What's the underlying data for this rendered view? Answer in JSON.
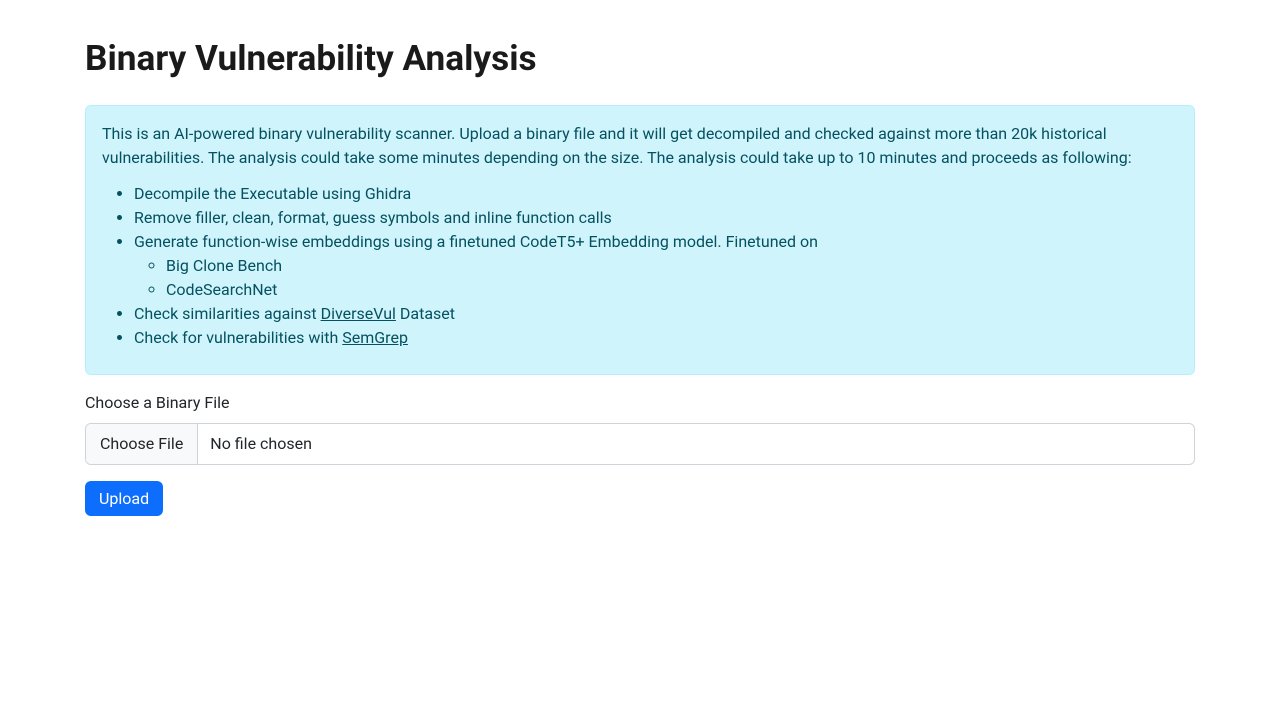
{
  "header": {
    "title": "Binary Vulnerability Analysis"
  },
  "info": {
    "intro": "This is an AI-powered binary vulnerability scanner. Upload a binary file and it will get decompiled and checked against more than 20k historical vulnerabilities. The analysis could take some minutes depending on the size. The analysis could take up to 10 minutes and proceeds as following:",
    "steps": {
      "s1": "Decompile the Executable using Ghidra",
      "s2": "Remove filler, clean, format, guess symbols and inline function calls",
      "s3": "Generate function-wise embeddings using a finetuned CodeT5+ Embedding model. Finetuned on",
      "s3a": "Big Clone Bench",
      "s3b": "CodeSearchNet",
      "s4_pre": "Check similarities against ",
      "s4_link": "DiverseVul",
      "s4_post": " Dataset",
      "s5_pre": "Check for vulnerabilities with ",
      "s5_link": "SemGrep"
    }
  },
  "form": {
    "file_label": "Choose a Binary File",
    "choose_file_button": "Choose File",
    "no_file_text": "No file chosen",
    "upload_button": "Upload"
  }
}
